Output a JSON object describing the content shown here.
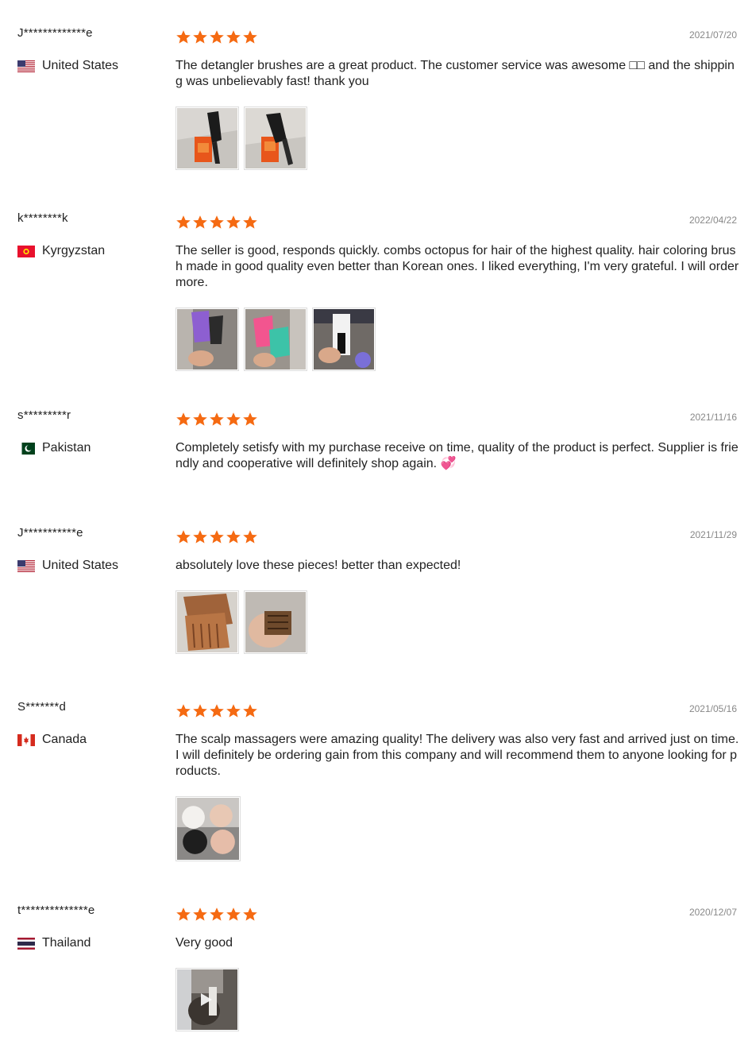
{
  "colors": {
    "star": "#f56a12",
    "date": "#888888",
    "text": "#222222"
  },
  "reviews": [
    {
      "user": "J*************e",
      "country": "United States",
      "flag": "us-flag-icon",
      "rating": 5,
      "date": "2021/07/20",
      "text": "The detangler brushes are a great product. The customer service was awesome □□ and the shipping was unbelievably fast! thank you",
      "photos": [
        "detangler-brush-photo",
        "detangler-brush-photo"
      ]
    },
    {
      "user": "k********k",
      "country": "Kyrgyzstan",
      "flag": "kg-flag-icon",
      "rating": 5,
      "date": "2022/04/22",
      "text": "The seller is good, responds quickly. combs octopus for hair of the highest quality. hair coloring brush made in good quality even better than Korean ones. I liked everything, I'm very grateful. I will order more.",
      "photos": [
        "purple-comb-photo",
        "pink-teal-comb-photo",
        "coloring-brush-photo"
      ]
    },
    {
      "user": "s*********r",
      "country": "Pakistan",
      "flag": "pk-flag-icon",
      "rating": 5,
      "date": "2021/11/16",
      "text": "Completely setisfy with my purchase receive on time, quality of the product is perfect. Supplier is friendly and cooperative will definitely shop again. 💞",
      "photos": []
    },
    {
      "user": "J***********e",
      "country": "United States",
      "flag": "us-flag-icon",
      "rating": 5,
      "date": "2021/11/29",
      "text": "absolutely love these pieces! better than expected!",
      "photos": [
        "amber-comb-photo",
        "comb-in-hand-photo"
      ]
    },
    {
      "user": "S*******d",
      "country": "Canada",
      "flag": "ca-flag-icon",
      "rating": 5,
      "date": "2021/05/16",
      "text": "The scalp massagers were amazing quality! The delivery was also very fast and arrived just on time. I will definitely be ordering gain from this company and will recommend them to anyone looking for products.",
      "photos": [
        "scalp-massagers-photo"
      ]
    },
    {
      "user": "t**************e",
      "country": "Thailand",
      "flag": "th-flag-icon",
      "rating": 5,
      "date": "2020/12/07",
      "text": "Very good",
      "photos": [
        "video-thumbnail-photo"
      ]
    }
  ]
}
